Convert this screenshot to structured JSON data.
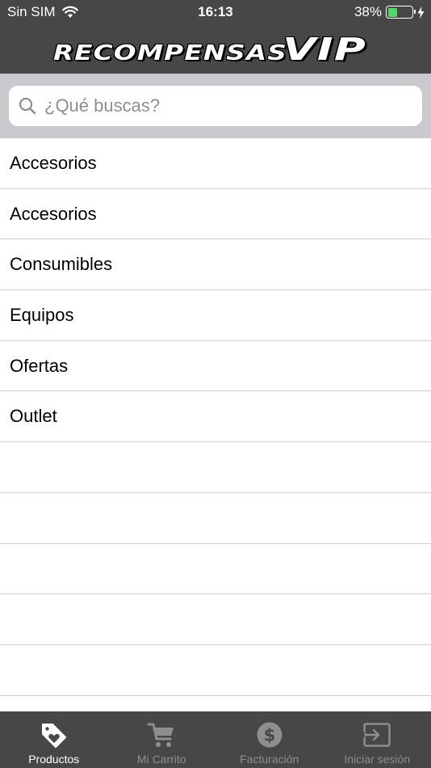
{
  "status_bar": {
    "carrier": "Sin SIM",
    "time": "16:13",
    "battery": "38%",
    "battery_level": 0.38
  },
  "header": {
    "logo_word1": "RECOMPENSAS",
    "logo_word2": "VIP"
  },
  "search": {
    "placeholder": "¿Qué buscas?"
  },
  "categories": [
    "Accesorios",
    "Accesorios",
    "Consumibles",
    "Equipos",
    "Ofertas",
    "Outlet"
  ],
  "tabs": [
    {
      "label": "Productos",
      "icon": "tag-heart-icon",
      "active": true
    },
    {
      "label": "Mi Carrito",
      "icon": "cart-icon",
      "active": false
    },
    {
      "label": "Facturación",
      "icon": "dollar-circle-icon",
      "active": false
    },
    {
      "label": "Iniciar sesión",
      "icon": "login-icon",
      "active": false
    }
  ],
  "colors": {
    "bar_background": "#474747",
    "tab_active": "#ffffff",
    "tab_inactive": "#8e8e8e",
    "battery_fill": "#4cd964"
  }
}
